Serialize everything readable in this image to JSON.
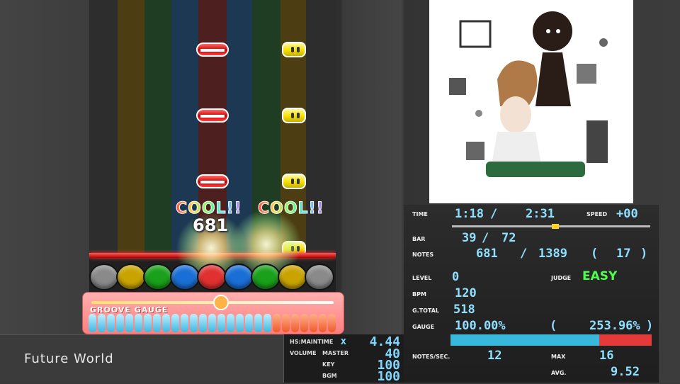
{
  "judgements": [
    {
      "text": "COOL!!"
    },
    {
      "text": "COOL!!"
    }
  ],
  "combo": "681",
  "gauge": {
    "label": "GROOVE GAUGE",
    "fill_fraction": 0.74
  },
  "song": {
    "title": "Future World"
  },
  "volume": {
    "hs_label": "HS:MAINTIME",
    "hs_x": "x",
    "hs_value": "4.44",
    "volume_label": "VOLUME",
    "master_label": "MASTER",
    "master_value": "40",
    "key_label": "KEY",
    "key_value": "100",
    "bgm_label": "BGM",
    "bgm_value": "100"
  },
  "stats": {
    "time_label": "TIME",
    "time_current": "1:18",
    "time_sep": "/",
    "time_total": "2:31",
    "speed_label": "SPEED",
    "speed_value": "+00",
    "progress_fraction": 0.52,
    "bar_label": "BAR",
    "bar_current": "39",
    "bar_sep": "/",
    "bar_total": "72",
    "notes_label": "NOTES",
    "notes_current": "681",
    "notes_sep": "/",
    "notes_total": "1389",
    "notes_paren_value": "17",
    "level_label": "LEVEL",
    "level_value": "0",
    "judge_label": "JUDGE",
    "judge_value": "EASY",
    "bpm_label": "BPM",
    "bpm_value": "120",
    "gtotal_label": "G.TOTAL",
    "gtotal_value": "518",
    "gauge_label": "GAUGE",
    "gauge_value": "100.00%",
    "gauge_max": "253.96%",
    "gauge_fraction": 0.74,
    "nps_label": "NOTES/SEC.",
    "nps_value": "12",
    "max_label": "MAX",
    "max_value": "16",
    "avg_label": "AVG.",
    "avg_value": "9.52"
  },
  "colors": {
    "accent_blue": "#8fe0ff",
    "judge_easy": "#4dff4d",
    "gauge_cyan": "#38b9dc",
    "gauge_red": "#e53a3a"
  }
}
